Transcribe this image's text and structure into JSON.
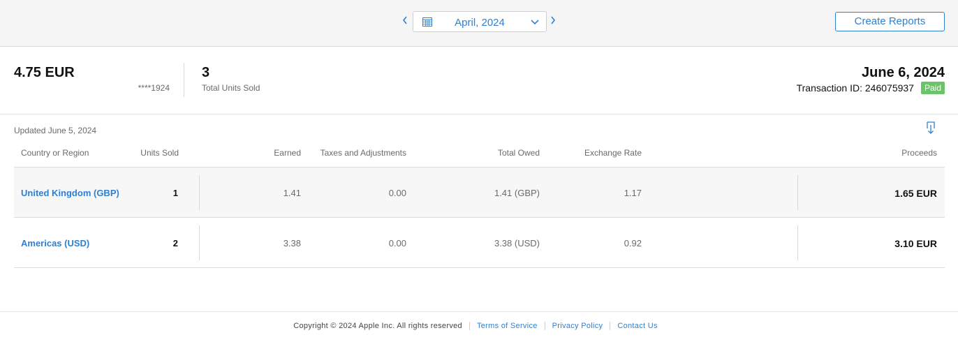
{
  "toolbar": {
    "month": "April, 2024",
    "prev_icon": "chevron-left-icon",
    "next_icon": "chevron-right-icon",
    "calendar_icon": "calendar-icon",
    "dropdown_icon": "chevron-down-icon",
    "create_reports_label": "Create Reports",
    "accent": "#2f7fd0"
  },
  "summary": {
    "total_amount": "4.75 EUR",
    "account_mask": "****1924",
    "units_count": "3",
    "units_label": "Total Units Sold",
    "pay_date": "June 6, 2024",
    "transaction_label": "Transaction ID: 246075937",
    "status_badge": "Paid",
    "status_color": "#6cc36a"
  },
  "table": {
    "updated": "Updated June 5, 2024",
    "download_icon": "download-icon",
    "columns": {
      "region": "Country or Region",
      "units": "Units Sold",
      "earned": "Earned",
      "taxes": "Taxes and Adjustments",
      "total_owed": "Total Owed",
      "exchange_rate": "Exchange Rate",
      "proceeds": "Proceeds"
    },
    "rows": [
      {
        "region": "United Kingdom (GBP)",
        "units": "1",
        "earned": "1.41",
        "taxes": "0.00",
        "total_owed": "1.41 (GBP)",
        "exchange_rate": "1.17",
        "proceeds": "1.65 EUR"
      },
      {
        "region": "Americas (USD)",
        "units": "2",
        "earned": "3.38",
        "taxes": "0.00",
        "total_owed": "3.38 (USD)",
        "exchange_rate": "0.92",
        "proceeds": "3.10 EUR"
      }
    ]
  },
  "footer": {
    "copyright": "Copyright © 2024 Apple Inc. All rights reserved",
    "terms": "Terms of Service",
    "privacy": "Privacy Policy",
    "contact": "Contact Us"
  }
}
